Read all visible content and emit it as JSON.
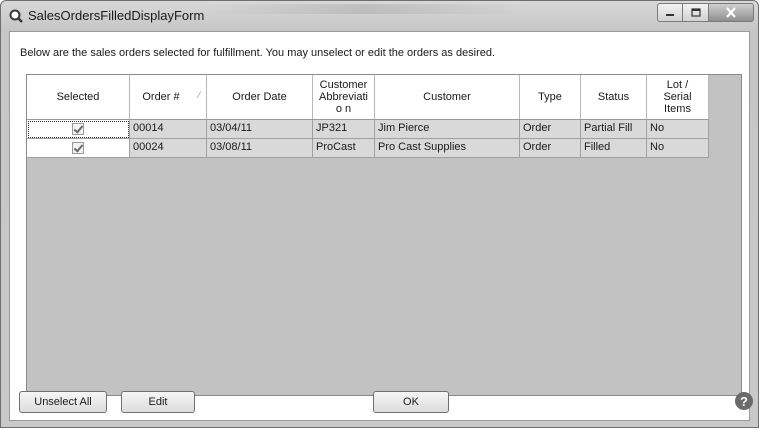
{
  "window": {
    "title": "SalesOrdersFilledDisplayForm"
  },
  "instructions": "Below are the sales orders selected for fulfillment. You may unselect or edit the orders as desired.",
  "grid": {
    "columns": {
      "selected": "Selected",
      "order_num": "Order #",
      "order_date": "Order Date",
      "customer_abbrev": "Customer Abbreviatio n",
      "customer": "Customer",
      "type": "Type",
      "status": "Status",
      "lot_serial": "Lot / Serial Items"
    },
    "rows": [
      {
        "selected": true,
        "order_num": "00014",
        "order_date": "03/04/11",
        "customer_abbrev": "JP321",
        "customer": "Jim Pierce",
        "type": "Order",
        "status": "Partial Fill",
        "lot_serial": "No"
      },
      {
        "selected": true,
        "order_num": "00024",
        "order_date": "03/08/11",
        "customer_abbrev": "ProCast",
        "customer": "Pro Cast Supplies",
        "type": "Order",
        "status": "Filled",
        "lot_serial": "No"
      }
    ]
  },
  "buttons": {
    "unselect_all": "Unselect All",
    "edit": "Edit",
    "ok": "OK"
  },
  "help_glyph": "?",
  "icons": {
    "app": "magnifier-icon",
    "minimize": "minimize-icon",
    "maximize": "maximize-icon",
    "close": "close-icon",
    "help": "help-icon"
  }
}
